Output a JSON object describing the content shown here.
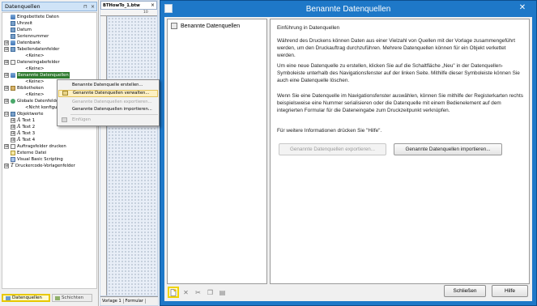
{
  "left_panel": {
    "title": "Datenquellen",
    "header_buttons": [
      "pin-icon",
      "close-icon"
    ],
    "tree": [
      {
        "label": "Eingebettete Daten",
        "icon": "database-icon",
        "level": 1
      },
      {
        "label": "Uhrzeit",
        "icon": "field-icon",
        "level": 1
      },
      {
        "label": "Datum",
        "icon": "field-icon",
        "level": 1
      },
      {
        "label": "Seriennummer",
        "icon": "field-icon",
        "level": 1
      },
      {
        "label": "Datenbank",
        "icon": "database-icon",
        "level": 0,
        "expander": "⊞"
      },
      {
        "label": "Tabellendatenfelder",
        "icon": "field-icon",
        "level": 0,
        "expander": "⊞"
      },
      {
        "label": "<Keine>",
        "level": 2
      },
      {
        "label": "Dateneingabefelder",
        "icon": "form-icon",
        "level": 0,
        "expander": "⊞"
      },
      {
        "label": "<Keine>",
        "level": 2
      },
      {
        "label": "Benannte Datenquellen",
        "icon": "database-icon",
        "level": 0,
        "expander": "⊞",
        "selected": true
      },
      {
        "label": "<Keine>",
        "level": 2
      },
      {
        "label": "Bibliotheken",
        "icon": "library-icon",
        "level": 0,
        "expander": "⊞"
      },
      {
        "label": "<Keine>",
        "level": 2
      },
      {
        "label": "Globale Datenfelder",
        "icon": "globe-icon",
        "level": 0,
        "expander": "⊞"
      },
      {
        "label": "<Nicht konfiguriert>",
        "level": 2
      },
      {
        "label": "Objektwerte",
        "icon": "object-icon",
        "level": 0,
        "expander": "⊟"
      },
      {
        "label": "Text 1",
        "icon": "text-icon",
        "level": 1,
        "expander": "⊞"
      },
      {
        "label": "Text 2",
        "icon": "text-icon",
        "level": 1,
        "expander": "⊞"
      },
      {
        "label": "Text 3",
        "icon": "text-icon",
        "level": 1,
        "expander": "⊞"
      },
      {
        "label": "Text 4",
        "icon": "text-icon",
        "level": 1,
        "expander": "⊞"
      },
      {
        "label": "Auftragsfelder drucken",
        "icon": "print-icon",
        "level": 0,
        "expander": "⊞"
      },
      {
        "label": "Externe Datei",
        "icon": "file-icon",
        "level": 0
      },
      {
        "label": "Visual Basic Scripting",
        "icon": "script-icon",
        "level": 0
      },
      {
        "label": "Druckercode-Vorlagenfelder",
        "icon": "template-icon",
        "level": 0,
        "expander": "⊞"
      }
    ],
    "footer_tabs": {
      "datenquellen": "Datenquellen",
      "schichten": "Schichten"
    }
  },
  "context_menu": {
    "items": [
      {
        "label": "Benannte Datenquelle erstellen...",
        "disabled": false
      },
      {
        "label": "Genannte Datenquellen verwalten...",
        "disabled": false,
        "hover": true
      },
      {
        "label": "Genannte Datenquellen exportieren...",
        "disabled": true
      },
      {
        "label": "Genannte Datenquellen importieren...",
        "disabled": false
      },
      {
        "label": "Einfügen",
        "disabled": true
      }
    ]
  },
  "document": {
    "tab_label": "BTHowTo_1.btw",
    "ruler_number": "10",
    "footer_tabs": [
      "Vorlage 1",
      "Formular"
    ]
  },
  "dialog": {
    "title": "Benannte Datenquellen",
    "close_glyph": "✕",
    "nav_item": "Benannte Datenquellen",
    "heading": "Einführung in Datenquellen",
    "paragraphs": [
      "Während des Druckens können Daten aus einer Vielzahl von Quellen mit der Vorlage zusammengeführt werden, um den Druckauftrag durchzuführen. Mehrere Datenquellen können für ein Objekt verkettet werden.",
      "Um eine neue Datenquelle zu erstellen, klicken Sie auf die Schaltfläche „Neu\" in der Datenquellen-Symboleiste unterhalb des Navigationsfenster auf der linken Seite. Mithilfe dieser Symboleiste können Sie auch eine Datenquelle löschen.",
      "Wenn Sie eine Datenquelle im Navigationsfenster auswählen, können Sie mithilfe der Registerkarten rechts beispielsweise eine Nummer serialisieren oder die Datenquelle mit einem Bedienelement auf dem integrierten Formular für die Dateneingabe zum Druckzeitpunkt verknüpfen.",
      "Für weitere Informationen drücken Sie \"Hilfe\"."
    ],
    "export_button": "Genannte Datenquellen exportieren...",
    "import_button": "Genannte Datenquellen importieren...",
    "close_button": "Schließen",
    "help_button": "Hilfe",
    "toolbar": [
      "new-icon",
      "delete-icon",
      "cut-icon",
      "copy-icon",
      "paste-icon"
    ]
  }
}
